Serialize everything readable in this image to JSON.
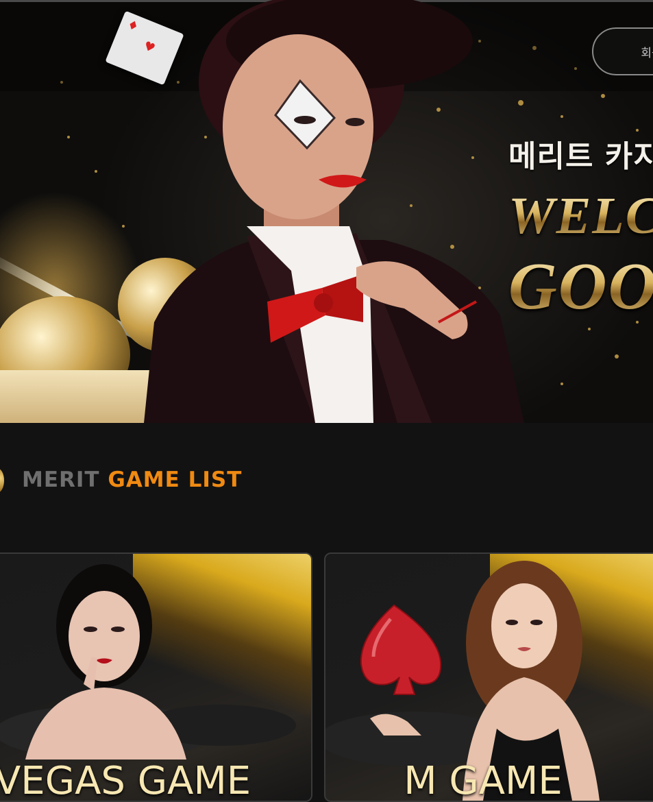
{
  "header": {
    "join_button_label": "회원",
    "hero_kicker": "메리트 카지",
    "hero_line1": "WELC",
    "hero_line2": "GOO"
  },
  "section": {
    "title_part1": "MERIT",
    "title_part2": "GAME LIST"
  },
  "games": [
    {
      "label": "VEGAS GAME"
    },
    {
      "label": "M GAME"
    }
  ],
  "colors": {
    "page_bg": "#121212",
    "accent_orange": "#f08a12",
    "title_gray": "#6f6f6f",
    "gold_text": "#f7e7b2",
    "bow_red": "#d01818"
  }
}
